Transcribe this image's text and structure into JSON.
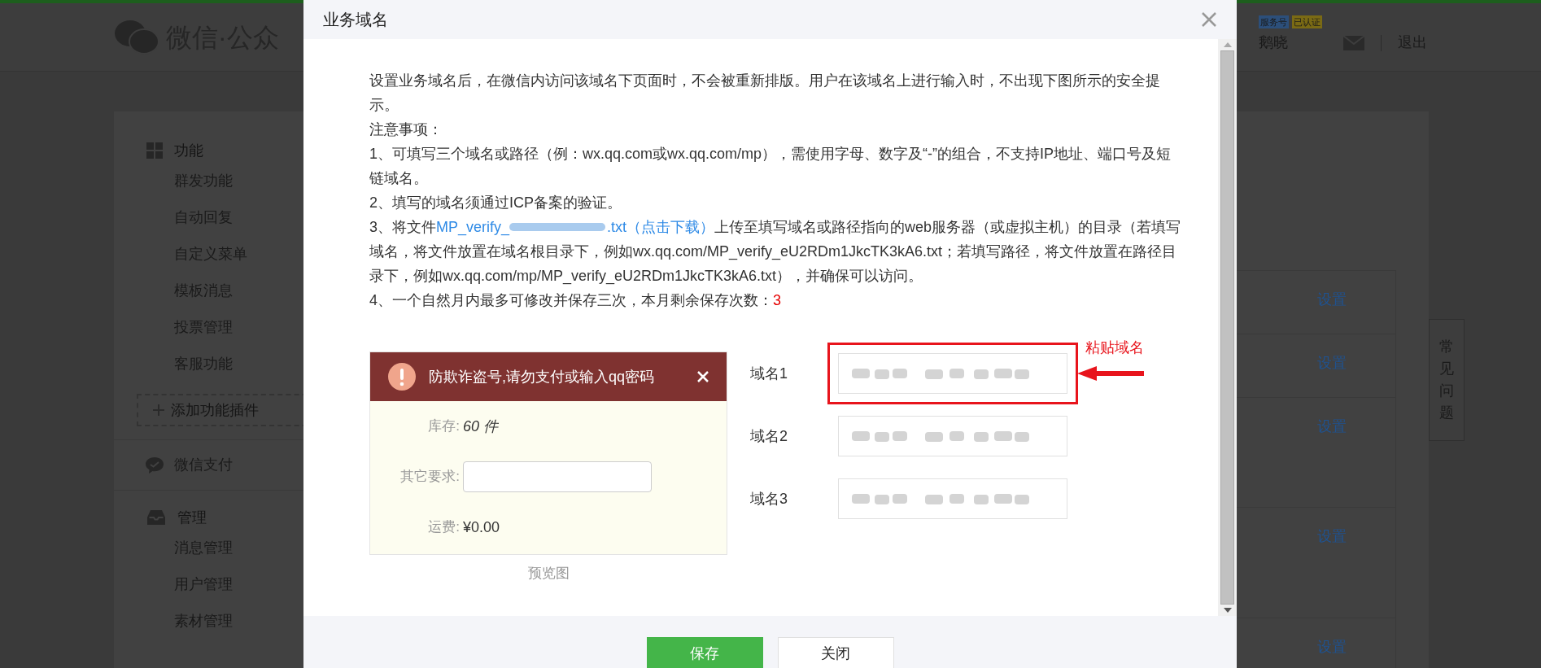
{
  "header": {
    "logo_text": "微信·公众",
    "badges": [
      {
        "label": "服务号",
        "color": "#2c4f7a"
      },
      {
        "label": "已认证",
        "color": "#7a6a14"
      }
    ],
    "user": "鹅晓",
    "logout": "退出"
  },
  "sidebar": [
    {
      "kind": "group",
      "title": "功能",
      "items": [
        "群发功能",
        "自动回复",
        "自定义菜单",
        "模板消息",
        "投票管理",
        "客服功能"
      ]
    },
    {
      "kind": "add",
      "title": "添加功能插件"
    },
    {
      "kind": "link",
      "title": "微信支付"
    },
    {
      "kind": "group",
      "title": "管理",
      "items": [
        "消息管理",
        "用户管理",
        "素材管理"
      ]
    }
  ],
  "rows": [
    {
      "action": "设置"
    },
    {
      "action": "设置"
    },
    {
      "action": "设置"
    },
    {
      "action": "设置"
    },
    {
      "action": "设置"
    }
  ],
  "faq_tab": "常见问题",
  "dialog": {
    "title": "业务域名",
    "paragraphs": [
      {
        "kind": "text",
        "text": "设置业务域名后，在微信内访问该域名下页面时，不会被重新排版。用户在该域名上进行输入时，不出现下图所示的安全提示。"
      },
      {
        "kind": "text",
        "text": "注意事项："
      },
      {
        "kind": "text",
        "text": "1、可填写三个域名或路径（例：wx.qq.com或wx.qq.com/mp），需使用字母、数字及“-”的组合，不支持IP地址、端口号及短链域名。"
      },
      {
        "kind": "text",
        "text": "2、填写的域名须通过ICP备案的验证。"
      },
      {
        "kind": "link",
        "before": "3、将文件",
        "link_start": "MP_verify_",
        "link_end": ".txt（点击下载）",
        "after": "上传至填写域名或路径指向的web服务器（或虚拟主机）的目录（若填写域名，将文件放置在域名根目录下，例如wx.qq.com/MP_verify_eU2RDm1JkcTK3kA6.txt；若填写路径，将文件放置在路径目录下，例如wx.qq.com/mp/MP_verify_eU2RDm1JkcTK3kA6.txt），并确保可以访问。"
      },
      {
        "kind": "count",
        "text": "4、一个自然月内最多可修改并保存三次，本月剩余保存次数：",
        "count": "3"
      }
    ],
    "preview": {
      "banner": "防欺诈盗号,请勿支付或输入qq密码",
      "rows": [
        {
          "kind": "value",
          "label": "库存:",
          "value": "60 件"
        },
        {
          "kind": "field",
          "label": "其它要求:"
        },
        {
          "kind": "value",
          "label": "运费:",
          "value": "¥0.00"
        }
      ],
      "caption": "预览图"
    },
    "domains": [
      {
        "label": "域名1",
        "highlighted": true
      },
      {
        "label": "域名2",
        "highlighted": false
      },
      {
        "label": "域名3",
        "highlighted": false
      }
    ],
    "annotation": "粘贴域名",
    "buttons": [
      {
        "label": "保存",
        "kind": "primary"
      },
      {
        "label": "关闭",
        "kind": "default"
      }
    ]
  }
}
